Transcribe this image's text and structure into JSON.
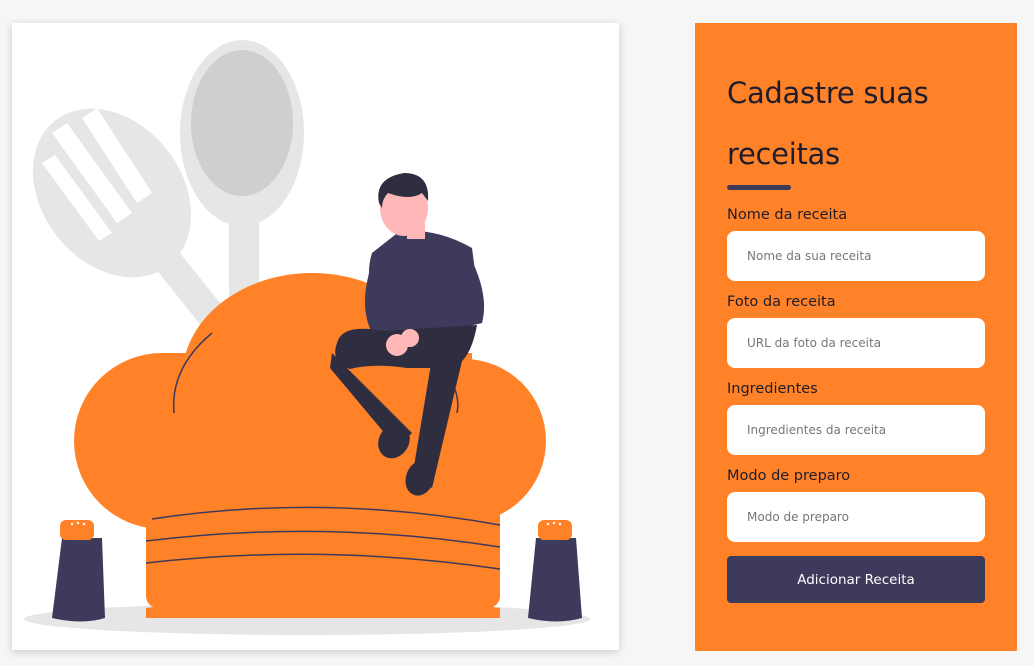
{
  "form": {
    "title": "Cadastre suas receitas",
    "fields": [
      {
        "label": "Nome da receita",
        "placeholder": "Nome da sua receita"
      },
      {
        "label": "Foto da receita",
        "placeholder": "URL da foto da receita"
      },
      {
        "label": "Ingredientes",
        "placeholder": "Ingredientes da receita"
      },
      {
        "label": "Modo de preparo",
        "placeholder": "Modo de preparo"
      }
    ],
    "submit_label": "Adicionar Receita"
  },
  "colors": {
    "accent": "#ff8228",
    "dark": "#3d3a5c",
    "background": "#f6f6f6"
  }
}
